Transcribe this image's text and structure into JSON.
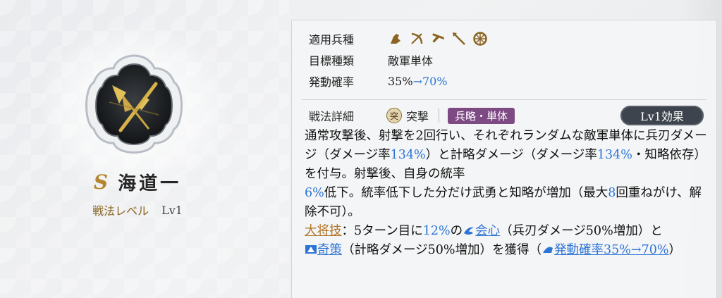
{
  "skill": {
    "rank": "S",
    "name": "海道一",
    "level_label": "戦法レベル",
    "level_value": "Lv1"
  },
  "info": {
    "troop_label": "適用兵種",
    "troop_icons": [
      "cavalry-icon",
      "bow-icon",
      "gun-icon",
      "spear-icon",
      "shield-icon"
    ],
    "target_label": "目標種類",
    "target_value": "敵軍単体",
    "rate_label": "発動確率",
    "rate_base": "35%",
    "rate_arrow": "→",
    "rate_max": "70%"
  },
  "detail": {
    "label": "戦法詳細",
    "type_icon_glyph": "突",
    "type_text": "突撃",
    "tag": "兵略・単体",
    "lv_effect_button": "Lv1効果"
  },
  "description": {
    "p1": "通常攻撃後、射撃を2回行い、それぞれランダムな敵軍単体に兵刃ダメージ（ダメージ率",
    "p1_rate": "134%",
    "p2": "）と計略ダメージ（ダメージ率",
    "p2_rate": "134%",
    "p3": "・知略依存）を付与。射撃後、自身の統率",
    "p3_pct": "6%",
    "p4": "低下。統率低下した分だけ武勇と知略が増加（最大",
    "p4_max": "8",
    "p5": "回重ねがけ、解除不可）。",
    "bonus_label": "大将技",
    "bonus_a": "：5ターン目に",
    "bonus_pct": "12%",
    "bonus_b": "の",
    "crit_label": "会心",
    "bonus_c": "（兵刃ダメージ50%増加）と",
    "strat_label": "奇策",
    "bonus_d": "（計略ダメージ50%増加）を獲得（",
    "rate_link": "発動確率35%→70%",
    "bonus_e": "）"
  },
  "colors": {
    "accent_blue": "#2d74d6",
    "tag_purple": "#7e4a84",
    "gold": "#b5852d"
  }
}
